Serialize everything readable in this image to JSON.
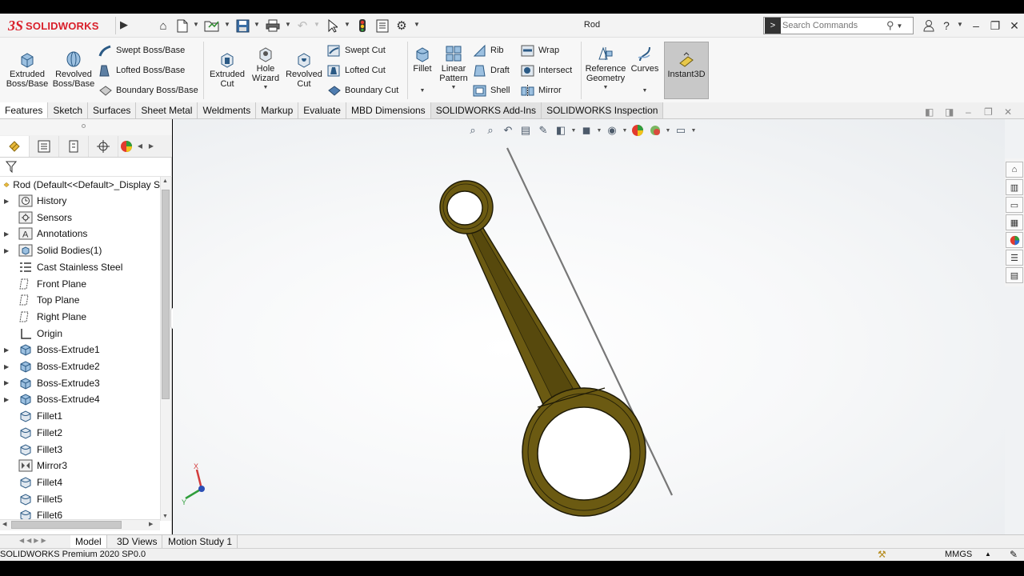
{
  "app": {
    "logo_ds": "3S",
    "logo_text": "SOLIDWORKS",
    "document_title": "Rod"
  },
  "search": {
    "placeholder": "Search Commands"
  },
  "ribbon": {
    "extruded_boss": "Extruded\nBoss/Base",
    "revolved_boss": "Revolved\nBoss/Base",
    "swept_boss": "Swept Boss/Base",
    "lofted_boss": "Lofted Boss/Base",
    "boundary_boss": "Boundary Boss/Base",
    "extruded_cut": "Extruded\nCut",
    "hole_wizard": "Hole\nWizard",
    "revolved_cut": "Revolved\nCut",
    "swept_cut": "Swept Cut",
    "lofted_cut": "Lofted Cut",
    "boundary_cut": "Boundary Cut",
    "fillet": "Fillet",
    "linear_pattern": "Linear\nPattern",
    "rib": "Rib",
    "draft": "Draft",
    "shell": "Shell",
    "wrap": "Wrap",
    "intersect": "Intersect",
    "mirror": "Mirror",
    "reference_geometry": "Reference\nGeometry",
    "curves": "Curves",
    "instant3d": "Instant3D"
  },
  "tabs": [
    {
      "label": "Features",
      "active": true
    },
    {
      "label": "Sketch"
    },
    {
      "label": "Surfaces"
    },
    {
      "label": "Sheet Metal"
    },
    {
      "label": "Weldments"
    },
    {
      "label": "Markup"
    },
    {
      "label": "Evaluate"
    },
    {
      "label": "MBD Dimensions"
    },
    {
      "label": "SOLIDWORKS Add-Ins"
    },
    {
      "label": "SOLIDWORKS Inspection"
    }
  ],
  "tree": {
    "root": "Rod  (Default<<Default>_Display S",
    "items": [
      {
        "label": "History",
        "expandable": true,
        "icon": "history-icon"
      },
      {
        "label": "Sensors",
        "expandable": false,
        "icon": "sensors-icon"
      },
      {
        "label": "Annotations",
        "expandable": true,
        "icon": "annotations-icon"
      },
      {
        "label": "Solid Bodies(1)",
        "expandable": true,
        "icon": "solid-bodies-icon"
      },
      {
        "label": "Cast Stainless Steel",
        "expandable": false,
        "icon": "material-icon"
      },
      {
        "label": "Front Plane",
        "expandable": false,
        "icon": "plane-icon"
      },
      {
        "label": "Top Plane",
        "expandable": false,
        "icon": "plane-icon"
      },
      {
        "label": "Right Plane",
        "expandable": false,
        "icon": "plane-icon"
      },
      {
        "label": "Origin",
        "expandable": false,
        "icon": "origin-icon"
      },
      {
        "label": "Boss-Extrude1",
        "expandable": true,
        "icon": "extrude-icon"
      },
      {
        "label": "Boss-Extrude2",
        "expandable": true,
        "icon": "extrude-icon"
      },
      {
        "label": "Boss-Extrude3",
        "expandable": true,
        "icon": "extrude-icon"
      },
      {
        "label": "Boss-Extrude4",
        "expandable": true,
        "icon": "extrude-icon"
      },
      {
        "label": "Fillet1",
        "expandable": false,
        "icon": "fillet-icon"
      },
      {
        "label": "Fillet2",
        "expandable": false,
        "icon": "fillet-icon"
      },
      {
        "label": "Fillet3",
        "expandable": false,
        "icon": "fillet-icon"
      },
      {
        "label": "Mirror3",
        "expandable": false,
        "icon": "mirror-icon"
      },
      {
        "label": "Fillet4",
        "expandable": false,
        "icon": "fillet-icon"
      },
      {
        "label": "Fillet5",
        "expandable": false,
        "icon": "fillet-icon"
      },
      {
        "label": "Fillet6",
        "expandable": false,
        "icon": "fillet-icon"
      }
    ]
  },
  "triad": {
    "x_label": "X",
    "y_label": "Y"
  },
  "bottom_tabs": [
    {
      "label": "Model",
      "active": true
    },
    {
      "label": "3D Views"
    },
    {
      "label": "Motion Study 1"
    }
  ],
  "status": {
    "version": "SOLIDWORKS Premium 2020 SP0.0",
    "units": "MMGS"
  },
  "colors": {
    "part_fill": "#6b5a12",
    "part_edge": "#1e1a06",
    "brand_red": "#d9202b"
  }
}
